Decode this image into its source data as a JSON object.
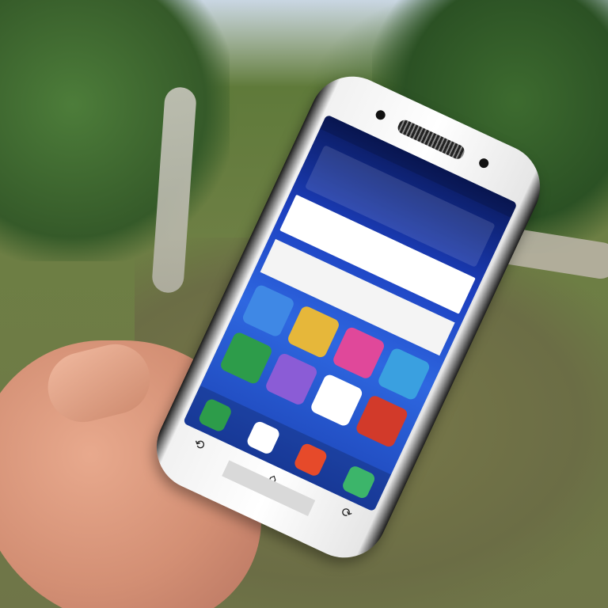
{
  "scene": {
    "description_type": "photo",
    "sky_color": "#d7dfe6",
    "foliage_color": "#3f6a2e",
    "water_color": "#6f7548",
    "road_color": "#bdb9ad",
    "skin_color": "#d99a7f"
  },
  "phone": {
    "body_color": "#f4f4f4",
    "screen_accent": "#2e67e0",
    "home_label": "",
    "screen": {
      "status_left": "",
      "status_right": "",
      "widget_text": "",
      "banner_text": "",
      "banner2_text": "",
      "apps": [
        {
          "icon": "clock-icon",
          "color": "#3f88e5",
          "label": ""
        },
        {
          "icon": "app-icon",
          "color": "#e6b73a",
          "label": ""
        },
        {
          "icon": "gallery-icon",
          "color": "#e0489a",
          "label": ""
        },
        {
          "icon": "app-icon",
          "color": "#3aa0e0",
          "label": ""
        },
        {
          "icon": "phone-icon",
          "color": "#2d9c4a",
          "label": ""
        },
        {
          "icon": "app-icon",
          "color": "#8b5cd6",
          "label": ""
        },
        {
          "icon": "app-icon",
          "color": "#ffffff",
          "label": ""
        },
        {
          "icon": "app-icon",
          "color": "#d23a2a",
          "label": ""
        }
      ],
      "dock": [
        {
          "icon": "phone-icon",
          "color": "#2d9c4a"
        },
        {
          "icon": "apps-grid-icon",
          "color": "#ffffff"
        },
        {
          "icon": "chrome-icon",
          "color": "#e64a2a"
        },
        {
          "icon": "camera-icon",
          "color": "#3cb56a"
        }
      ]
    },
    "nav_keys": [
      {
        "icon": "back-icon",
        "glyph": "⟲"
      },
      {
        "icon": "home-icon",
        "glyph": "⌂"
      },
      {
        "icon": "menu-icon",
        "glyph": "⟳"
      }
    ]
  }
}
